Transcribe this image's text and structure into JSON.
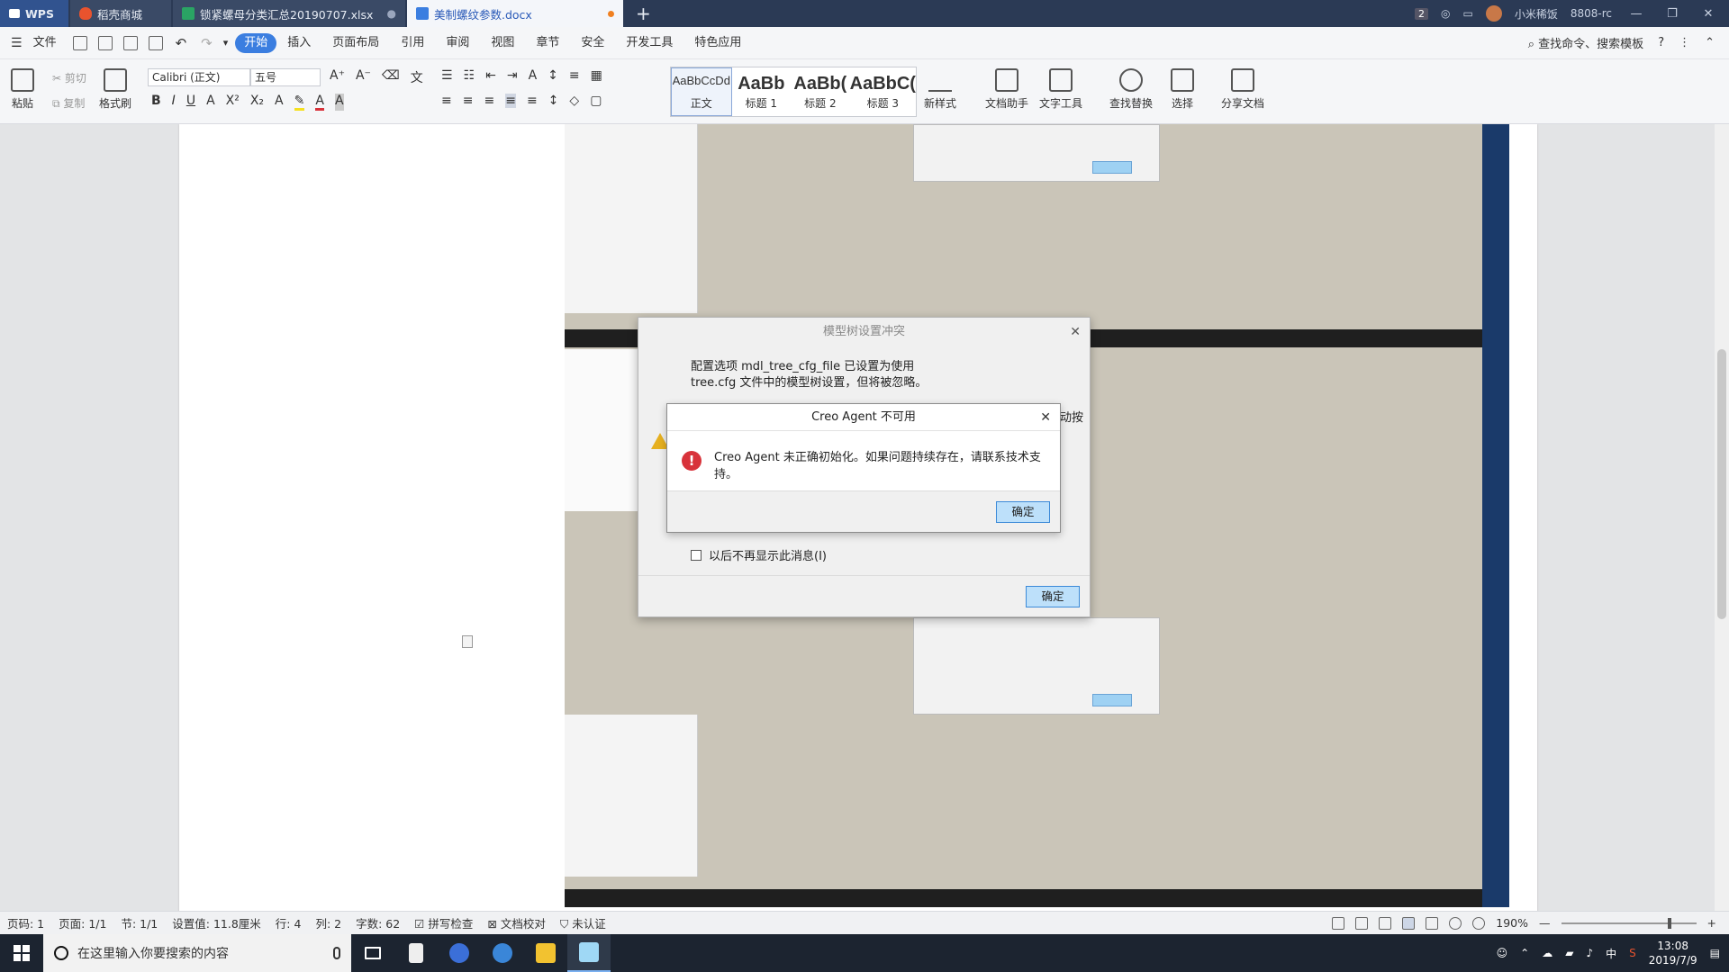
{
  "tabs": [
    {
      "label": "WPS",
      "icon": "wps-logo-icon",
      "color": "#31538f"
    },
    {
      "label": "稻壳商城",
      "icon": "flame-icon",
      "color": "#e8532e"
    },
    {
      "label": "锁紧螺母分类汇总20190707.xlsx",
      "icon": "spreadsheet-icon",
      "color": "#2aa464"
    },
    {
      "label": "美制螺纹参数.docx",
      "icon": "document-icon",
      "color": "#3b7ee0",
      "active": true
    }
  ],
  "titlebar": {
    "badge": "2",
    "user": "小米稀饭",
    "account": "8808-rc"
  },
  "menu": {
    "file": "文件",
    "items": [
      "开始",
      "插入",
      "页面布局",
      "引用",
      "审阅",
      "视图",
      "章节",
      "安全",
      "开发工具",
      "特色应用"
    ],
    "active": "开始",
    "search": "查找命令、搜索模板"
  },
  "ribbon": {
    "paste": "粘贴",
    "cut": "剪切",
    "copy": "复制",
    "format_painter": "格式刷",
    "font_name": "Calibri (正文)",
    "font_size": "五号",
    "styles": [
      {
        "sample": "AaBbCcDd",
        "label": "正文"
      },
      {
        "sample": "AaBb",
        "label": "标题 1"
      },
      {
        "sample": "AaBb(",
        "label": "标题 2"
      },
      {
        "sample": "AaBbC(",
        "label": "标题 3"
      }
    ],
    "new_style": "新样式",
    "doc_helper": "文档助手",
    "text_tools": "文字工具",
    "find_replace": "查找替换",
    "select": "选择",
    "share": "分享文档"
  },
  "dialog_outer": {
    "title": "模型树设置冲突",
    "line1": "配置选项 mdl_tree_cfg_file 已设置为使用",
    "line2": "tree.cfg 文件中的模型树设置，但将被忽略。",
    "trailing": "动按",
    "checkbox": "以后不再显示此消息(I)",
    "ok": "确定"
  },
  "dialog_inner": {
    "title": "Creo Agent 不可用",
    "message": "Creo Agent 未正确初始化。如果问题持续存在，请联系技术支持。",
    "ok": "确定"
  },
  "status": {
    "page_num": "页码: 1",
    "page": "页面: 1/1",
    "section": "节: 1/1",
    "setting": "设置值: 11.8厘米",
    "row": "行: 4",
    "col": "列: 2",
    "words": "字数: 62",
    "spell": "拼写检查",
    "proof": "文档校对",
    "cert": "未认证",
    "zoom": "190%"
  },
  "taskbar": {
    "search_placeholder": "在这里输入你要搜索的内容",
    "ime": "中",
    "time": "13:08",
    "date": "2019/7/9"
  }
}
